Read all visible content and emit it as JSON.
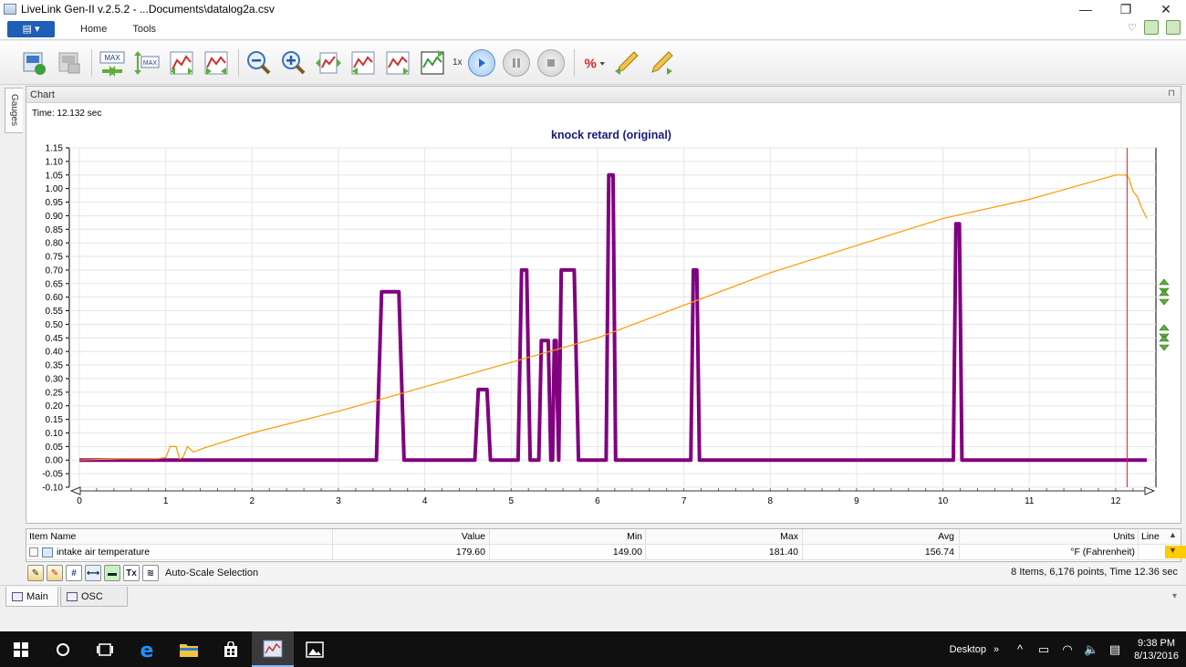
{
  "window": {
    "title": "LiveLink Gen-II  v.2.5.2 - ...Documents\\datalog2a.csv",
    "minimize": "—",
    "restore": "❐",
    "close": "✕"
  },
  "ribbon": {
    "file_menu": "▤ ▾",
    "tabs": [
      "Home",
      "Tools"
    ],
    "collapse_glyph": "♡"
  },
  "toolbar": {
    "max_label": "MAX",
    "speed_label": "1x"
  },
  "side_tab": {
    "label": "Gauges"
  },
  "chart_panel": {
    "header": "Chart",
    "pin": "⊓",
    "time_readout": "Time: 12.132 sec"
  },
  "chart_data": {
    "type": "line",
    "title": "knock retard (original)",
    "xlim": [
      0,
      12.36
    ],
    "ylim": [
      -0.1,
      1.15
    ],
    "x_ticks": [
      0,
      1,
      2,
      3,
      4,
      5,
      6,
      7,
      8,
      9,
      10,
      11,
      12
    ],
    "y_ticks": [
      1.15,
      1.1,
      1.05,
      1.0,
      0.95,
      0.9,
      0.85,
      0.8,
      0.75,
      0.7,
      0.65,
      0.6,
      0.55,
      0.5,
      0.45,
      0.4,
      0.35,
      0.3,
      0.25,
      0.2,
      0.15,
      0.1,
      0.05,
      0.0,
      -0.05,
      -0.1
    ],
    "y_tick_labels": [
      "1.15",
      "1.10",
      "1.05",
      "1.00",
      "0.95",
      "0.90",
      "0.85",
      "0.80",
      "0.75",
      "0.70",
      "0.65",
      "0.60",
      "0.55",
      "0.50",
      "0.45",
      "0.40",
      "0.35",
      "0.30",
      "0.25",
      "0.20",
      "0.15",
      "0.10",
      "0.05",
      "0.00",
      "-0.05",
      "-0.10"
    ],
    "cursor_x": 12.132,
    "grid": true,
    "series": [
      {
        "color": "#800080",
        "x": [
          0.0,
          3.44,
          3.5,
          3.7,
          3.76,
          4.58,
          4.62,
          4.72,
          4.76,
          5.08,
          5.12,
          5.18,
          5.22,
          5.32,
          5.35,
          5.43,
          5.46,
          5.48,
          5.5,
          5.52,
          5.55,
          5.58,
          5.6,
          5.73,
          5.78,
          6.1,
          6.13,
          6.18,
          6.21,
          7.08,
          7.11,
          7.15,
          7.18,
          10.12,
          10.15,
          10.19,
          10.22,
          12.36
        ],
        "y": [
          0.0,
          0.0,
          0.62,
          0.62,
          0.0,
          0.0,
          0.26,
          0.26,
          0.0,
          0.0,
          0.7,
          0.7,
          0.0,
          0.0,
          0.44,
          0.44,
          0.0,
          0.0,
          0.44,
          0.44,
          0.0,
          0.7,
          0.7,
          0.7,
          0.0,
          0.0,
          1.05,
          1.05,
          0.0,
          0.0,
          0.7,
          0.7,
          0.0,
          0.0,
          0.87,
          0.87,
          0.0,
          0.0
        ]
      },
      {
        "name": "intake air temperature",
        "color": "#ff9900",
        "x": [
          0.0,
          0.5,
          0.9,
          1.0,
          1.05,
          1.12,
          1.16,
          1.2,
          1.25,
          1.32,
          1.45,
          2.0,
          3.0,
          4.0,
          5.0,
          6.0,
          7.0,
          8.0,
          9.0,
          10.0,
          11.0,
          12.0,
          12.12,
          12.15,
          12.2,
          12.25,
          12.3,
          12.36
        ],
        "y": [
          0.0,
          0.005,
          0.005,
          0.01,
          0.05,
          0.05,
          0.005,
          0.01,
          0.05,
          0.03,
          0.045,
          0.1,
          0.18,
          0.27,
          0.36,
          0.45,
          0.57,
          0.69,
          0.79,
          0.89,
          0.96,
          1.05,
          1.05,
          1.04,
          0.99,
          0.97,
          0.93,
          0.89
        ]
      }
    ]
  },
  "table": {
    "headers": [
      "Item Name",
      "Value",
      "Min",
      "Max",
      "Avg",
      "Units",
      "Line"
    ],
    "rows": [
      {
        "name": "intake air temperature",
        "value": "179.60",
        "min": "149.00",
        "max": "181.40",
        "avg": "156.74",
        "units": "°F (Fahrenheit)",
        "line_color": "#ffcc00"
      }
    ],
    "scroll_up": "▲",
    "scroll_down": "▼"
  },
  "status": {
    "buttons": [
      "#",
      "Tx"
    ],
    "auto_scale": "Auto-Scale Selection",
    "info": "8 Items, 6,176 points, Time 12.36 sec"
  },
  "doc_tabs": [
    "Main",
    "OSC"
  ],
  "taskbar": {
    "desktop": "Desktop",
    "chevron": "»",
    "time": "9:38 PM",
    "date": "8/13/2016"
  }
}
